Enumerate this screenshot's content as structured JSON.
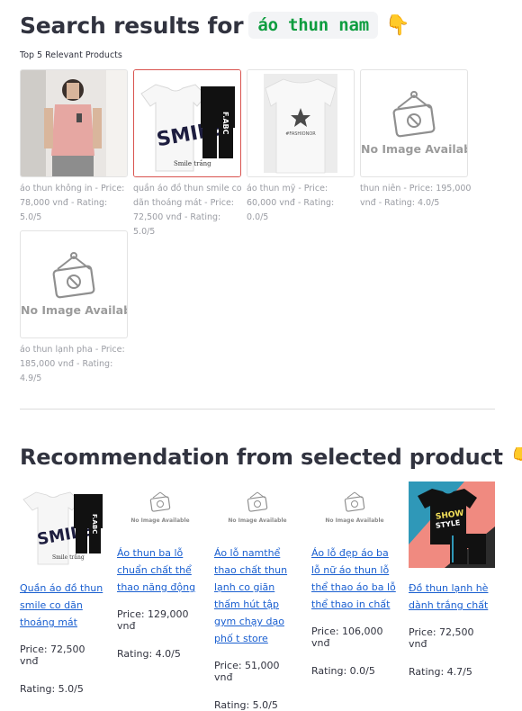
{
  "search": {
    "title_prefix": "Search results for",
    "query": "áo thun nam",
    "pointing_emoji": "👇",
    "subtitle": "Top 5 Relevant Products",
    "no_image_text": "No Image Available"
  },
  "products": [
    {
      "name": "áo thun không in",
      "price": "78,000 vnđ",
      "rating": "5.0/5",
      "caption": "áo thun không in - Price: 78,000 vnđ - Rating: 5.0/5",
      "image": "photo-man-pink-tank",
      "selected": false
    },
    {
      "name": "quần áo đồ thun smile co dãn thoáng mát",
      "price": "72,500 vnđ",
      "rating": "5.0/5",
      "caption": "quần áo đồ thun smile co dãn thoáng mát - Price: 72,500 vnđ - Rating: 5.0/5",
      "image": "photo-smile-set",
      "selected": true
    },
    {
      "name": "áo thun mỹ",
      "price": "60,000 vnđ",
      "rating": "0.0/5",
      "caption": "áo thun mỹ - Price: 60,000 vnđ - Rating: 0.0/5",
      "image": "photo-white-star-tee",
      "selected": false
    },
    {
      "name": "thun niên",
      "price": "195,000 vnđ",
      "rating": "4.0/5",
      "caption": "thun niên - Price: 195,000 vnđ - Rating: 4.0/5",
      "image": "no-image",
      "selected": false
    },
    {
      "name": "áo thun lạnh pha",
      "price": "185,000 vnđ",
      "rating": "4.9/5",
      "caption": "áo thun lạnh pha - Price: 185,000 vnđ - Rating: 4.9/5",
      "image": "no-image",
      "selected": false
    }
  ],
  "recommend": {
    "title": "Recommendation from selected product",
    "pointing_emoji": "👇",
    "items": [
      {
        "name": "Quần áo đồ thun smile co dãn thoáng mát",
        "price_text": "Price: 72,500 vnđ",
        "rating_text": "Rating: 5.0/5",
        "image": "photo-smile-set"
      },
      {
        "name": "Áo thun ba lỗ chuẩn chất thể thao năng động",
        "price_text": "Price: 129,000 vnđ",
        "rating_text": "Rating: 4.0/5",
        "image": "no-image"
      },
      {
        "name": "Áo lỗ namthể thao chất thun lạnh co giãn thấm hút tập gym chạy dạo phố t store",
        "price_text": "Price: 51,000 vnđ",
        "rating_text": "Rating: 5.0/5",
        "image": "no-image"
      },
      {
        "name": "Áo lỗ đẹp áo ba lỗ nữ áo thun lỗ thể thao áo ba lỗ thể thao in chất",
        "price_text": "Price: 106,000 vnđ",
        "rating_text": "Rating: 0.0/5",
        "image": "no-image"
      },
      {
        "name": "Đồ thun lạnh hè dành trắng chất",
        "price_text": "Price: 72,500 vnđ",
        "rating_text": "Rating: 4.7/5",
        "image": "photo-black-graphic-set"
      }
    ]
  },
  "colors": {
    "accent_green": "#0e9d3f",
    "link_blue": "#1a5fd0",
    "selected_border": "#d9534f"
  }
}
